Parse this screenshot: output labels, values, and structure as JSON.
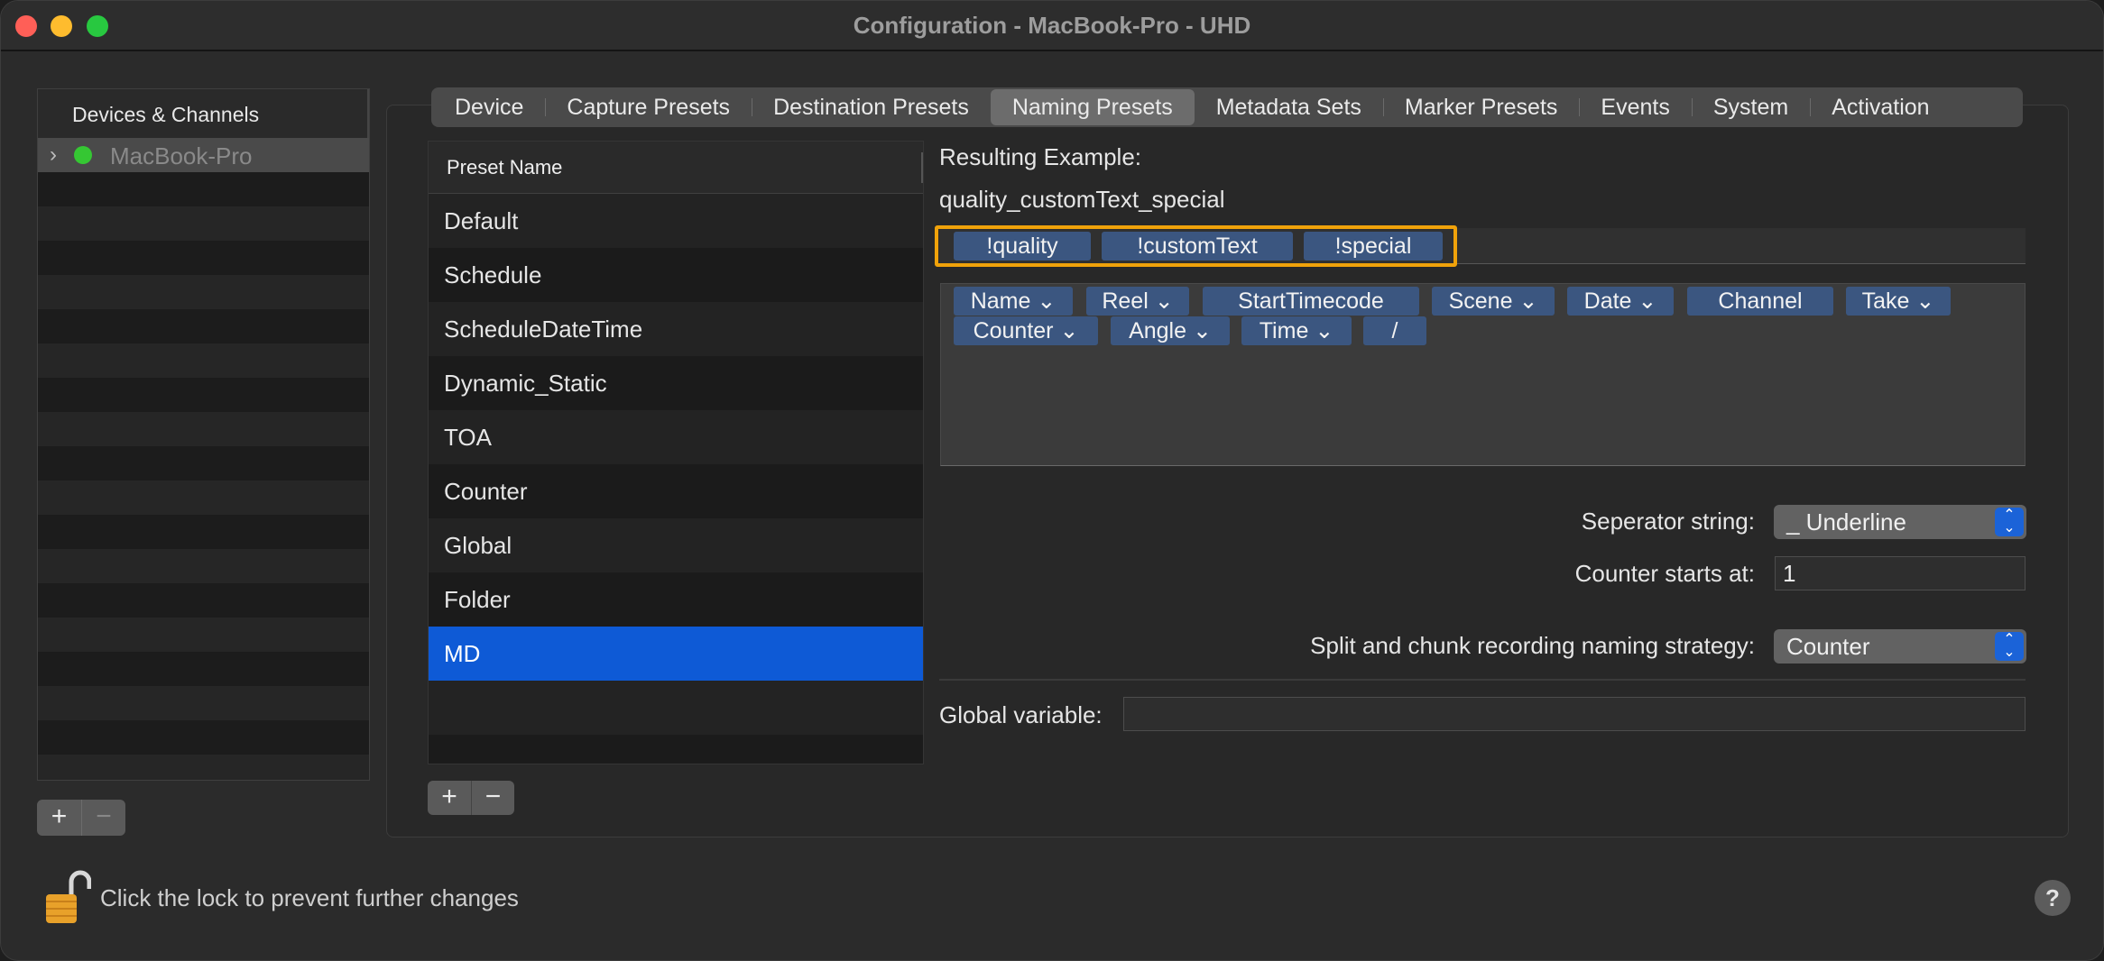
{
  "window": {
    "title": "Configuration - MacBook-Pro - UHD"
  },
  "sidebar": {
    "header": "Devices & Channels",
    "items": [
      {
        "label": "MacBook-Pro",
        "status_color": "#35c733"
      }
    ],
    "add_label": "+",
    "remove_label": "−"
  },
  "tabs": [
    {
      "label": "Device"
    },
    {
      "label": "Capture Presets"
    },
    {
      "label": "Destination Presets"
    },
    {
      "label": "Naming Presets",
      "selected": true
    },
    {
      "label": "Metadata Sets"
    },
    {
      "label": "Marker Presets"
    },
    {
      "label": "Events"
    },
    {
      "label": "System"
    },
    {
      "label": "Activation"
    }
  ],
  "preset_table": {
    "header": "Preset Name",
    "rows": [
      "Default",
      "Schedule",
      "ScheduleDateTime",
      "Dynamic_Static",
      "TOA",
      "Counter",
      "Global",
      "Folder",
      "MD"
    ],
    "selected": "MD",
    "add_label": "+",
    "remove_label": "−"
  },
  "naming": {
    "result_label": "Resulting Example:",
    "result_value": "quality_customText_special",
    "active_tokens": [
      "!quality",
      "!customText",
      "!special"
    ],
    "palette_tokens": [
      {
        "label": "Name",
        "dropdown": true
      },
      {
        "label": "Reel",
        "dropdown": true
      },
      {
        "label": "StartTimecode",
        "dropdown": false
      },
      {
        "label": "Scene",
        "dropdown": true
      },
      {
        "label": "Date",
        "dropdown": true
      },
      {
        "label": "Channel",
        "dropdown": false
      },
      {
        "label": "Take",
        "dropdown": true
      },
      {
        "label": "Counter",
        "dropdown": true
      },
      {
        "label": "Angle",
        "dropdown": true
      },
      {
        "label": "Time",
        "dropdown": true
      },
      {
        "label": "/",
        "dropdown": false
      }
    ],
    "separator_label": "Seperator string:",
    "separator_value": "_ Underline",
    "counter_label": "Counter starts at:",
    "counter_value": "1",
    "split_label": "Split and chunk recording naming strategy:",
    "split_value": "Counter",
    "global_label": "Global variable:",
    "global_value": ""
  },
  "footer": {
    "lock_text": "Click the lock to prevent further changes",
    "help_label": "?"
  },
  "colors": {
    "highlight": "#f0a20a",
    "selection": "#0e5ad6",
    "token": "#3b5680"
  }
}
